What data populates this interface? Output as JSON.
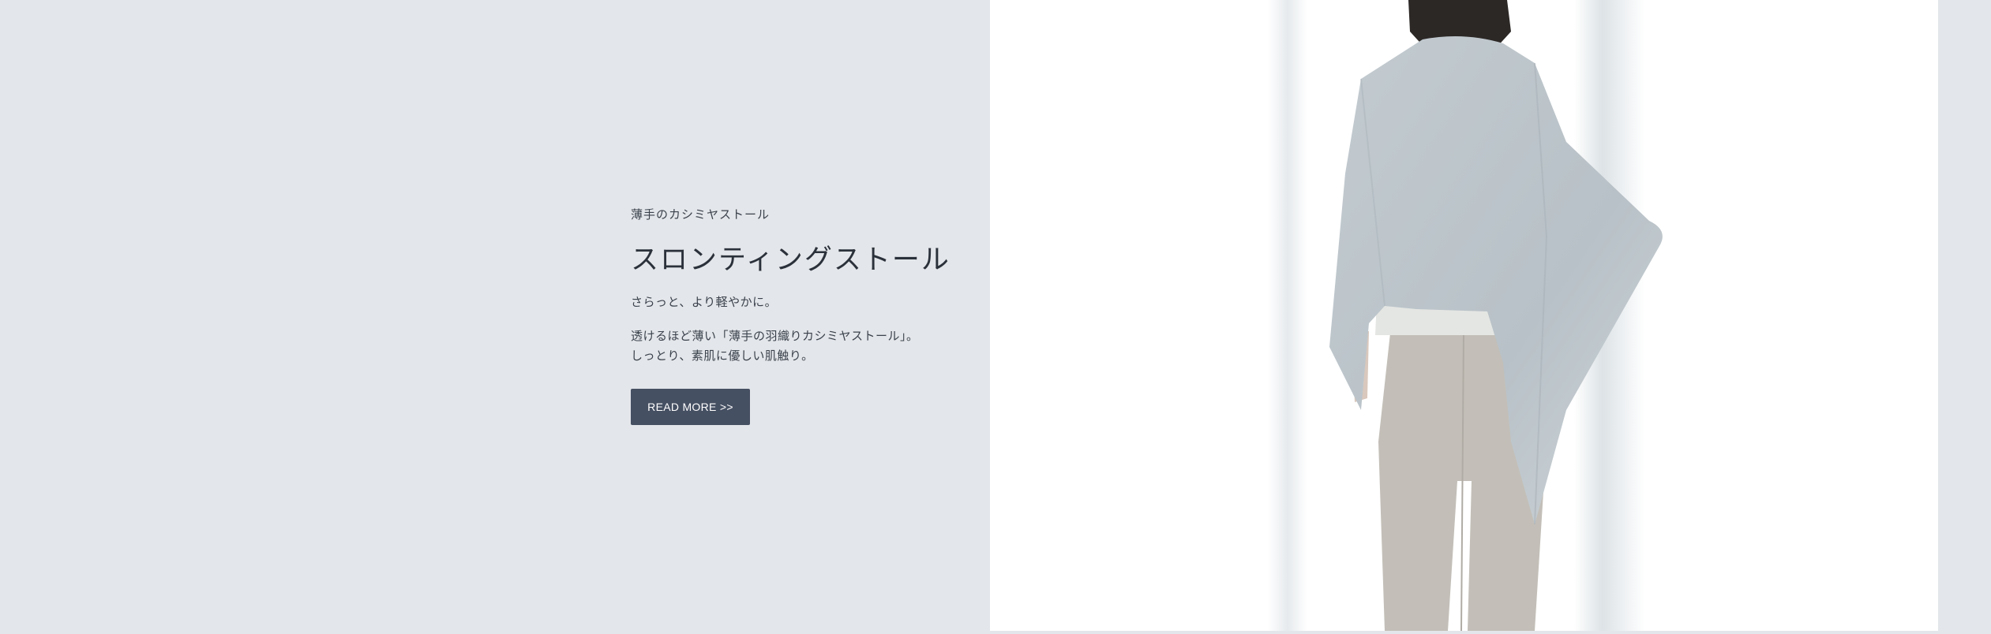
{
  "feature": {
    "eyebrow": "薄手のカシミヤストール",
    "title": "スロンティングストール",
    "lead": "さらっと、より軽やかに。",
    "body_line1": "透けるほど薄い「薄手の羽織りカシミヤストール」。",
    "body_line2": "しっとり、素肌に優しい肌触り。",
    "button_label": "READ MORE >>"
  },
  "colors": {
    "background": "#e3e6ea",
    "button": "#465063",
    "stole": "#bcc5ca",
    "pants": "#c3bfb8"
  }
}
